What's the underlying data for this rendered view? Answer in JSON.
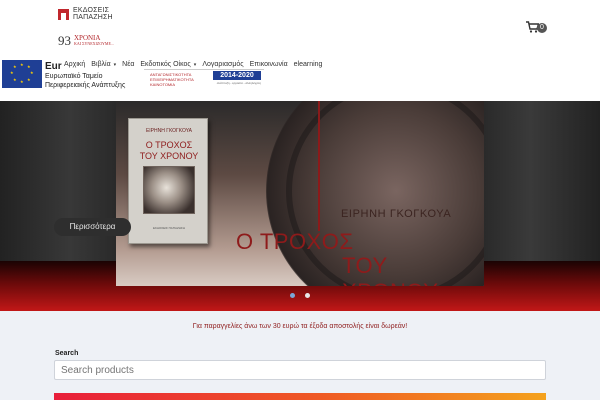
{
  "header": {
    "brand_line1": "ΕΚΔΟΣΕΙΣ",
    "brand_line2": "ΠΑΠΑΖΗΣΗ",
    "years_number": "93",
    "years_text": "ΧΡΟΝΙΑ",
    "years_tagline": "ΚΑΙ ΣΥΝΕΧΙΖΟΥΜΕ...",
    "cart_count": "0"
  },
  "eu": {
    "title": "Eur",
    "line1": "Ευρωπαϊκό Ταμείο",
    "line2": "Περιφερειακής Ανάπτυξης",
    "program_text": "ΑΝΤΑΓΩΝΙΣΤΙΚΟΤΗΤΑ ΕΠΙΧΕΙΡΗΜΑΤΙΚΟΤΗΤΑ ΚΑΙΝΟΤΟΜΙΑ",
    "program_years": "2014-2020",
    "program_footer": "ανάπτυξη - εργασία - αλληλεγγύη"
  },
  "nav": {
    "items": [
      {
        "label": "Αρχική"
      },
      {
        "label": "Βιβλία",
        "caret": "▾"
      },
      {
        "label": "Νέα"
      },
      {
        "label": "Εκδοτικός Οίκος",
        "caret": "▾"
      },
      {
        "label": "Λογαριασμός"
      },
      {
        "label": "Επικοινωνία"
      },
      {
        "label": "elearning"
      }
    ]
  },
  "hero": {
    "author": "ΕΙΡΗΝΗ ΓΚΟΓΚΟΥΑ",
    "title_line1": "Ο ΤΡΟΧΟΣ",
    "title_line2": "ΤΟΥ ΧΡΟΝΟΥ",
    "book_author": "ΕΙΡΗΝΗ ΓΚΟΓΚΟΥΑ",
    "book_title_line1": "Ο ΤΡΟΧΟΣ",
    "book_title_line2": "ΤΟΥ ΧΡΟΝΟΥ",
    "book_publisher": "ΕΚΔΟΣΕΙΣ ΠΑΠΑΖΗΣΗ",
    "more_button": "Περισσότερα",
    "slides_total": 2,
    "active_slide": 1
  },
  "notice": "Για παραγγελίες άνω των 30 ευρώ τα έξοδα αποστολής είναι δωρεάν!",
  "search": {
    "label": "Search",
    "placeholder": "Search products"
  },
  "colors": {
    "brand_red": "#c0272d",
    "title_red": "#8e1b1b",
    "eu_blue": "#1f3f95"
  }
}
